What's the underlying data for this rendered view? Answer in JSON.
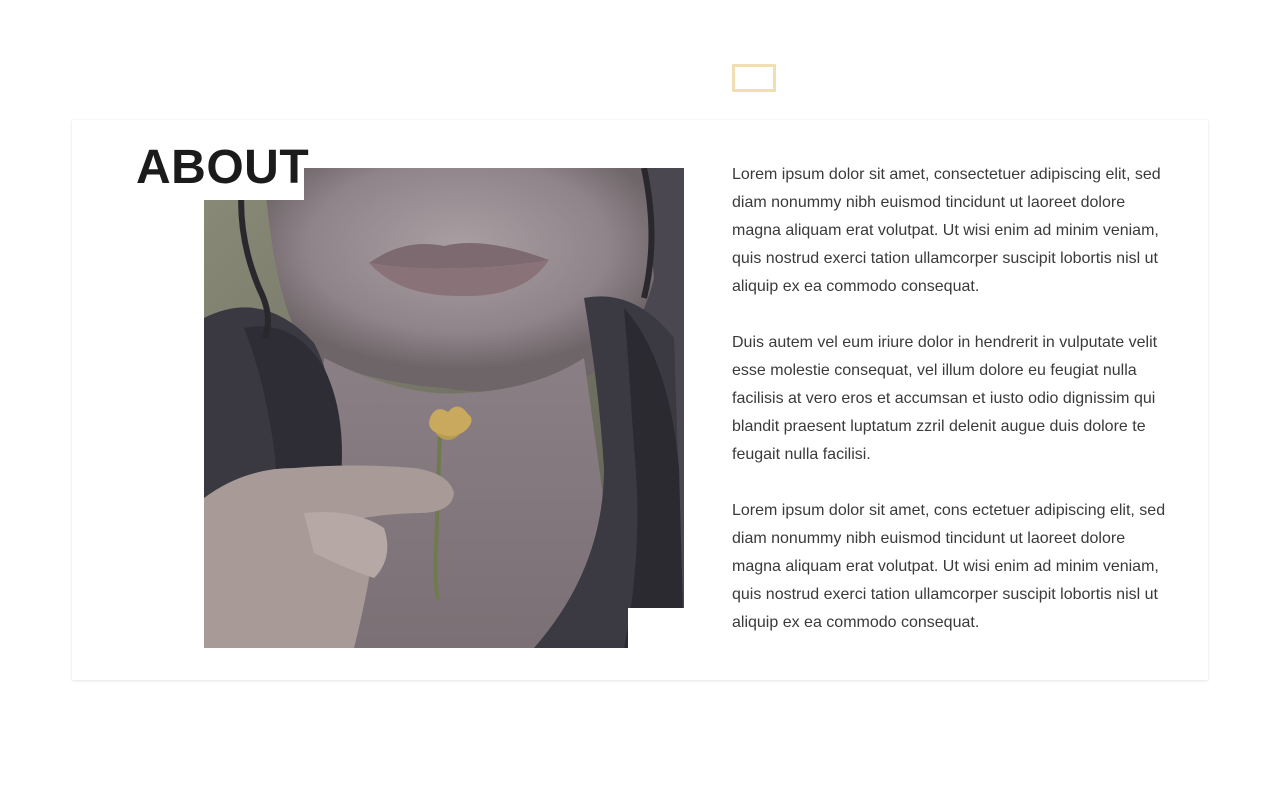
{
  "section": {
    "title": "ABOUT",
    "accent_color": "#f1dfb2",
    "photo": {
      "description_icon": "portrait-photo"
    },
    "paragraphs": [
      "Lorem ipsum dolor sit amet, consectetuer adipiscing elit, sed diam nonummy nibh euismod tincidunt ut laoreet dolore magna aliquam erat volutpat. Ut wisi enim ad minim veniam, quis nostrud exerci tation ullamcorper suscipit lobortis nisl ut aliquip ex ea commodo consequat.",
      "Duis autem vel eum iriure dolor in hendrerit in vulputate velit esse molestie consequat, vel illum dolore eu feugiat nulla facilisis at vero eros et accumsan et iusto odio dignissim qui blandit praesent luptatum zzril delenit augue duis dolore te feugait nulla facilisi.",
      "Lorem ipsum dolor sit amet, cons ectetuer adipiscing elit, sed diam nonummy nibh euismod tincidunt ut laoreet dolore magna aliquam erat volutpat. Ut wisi enim ad minim veniam, quis nostrud exerci tation ullamcorper suscipit lobortis nisl ut aliquip ex ea commodo consequat."
    ]
  }
}
